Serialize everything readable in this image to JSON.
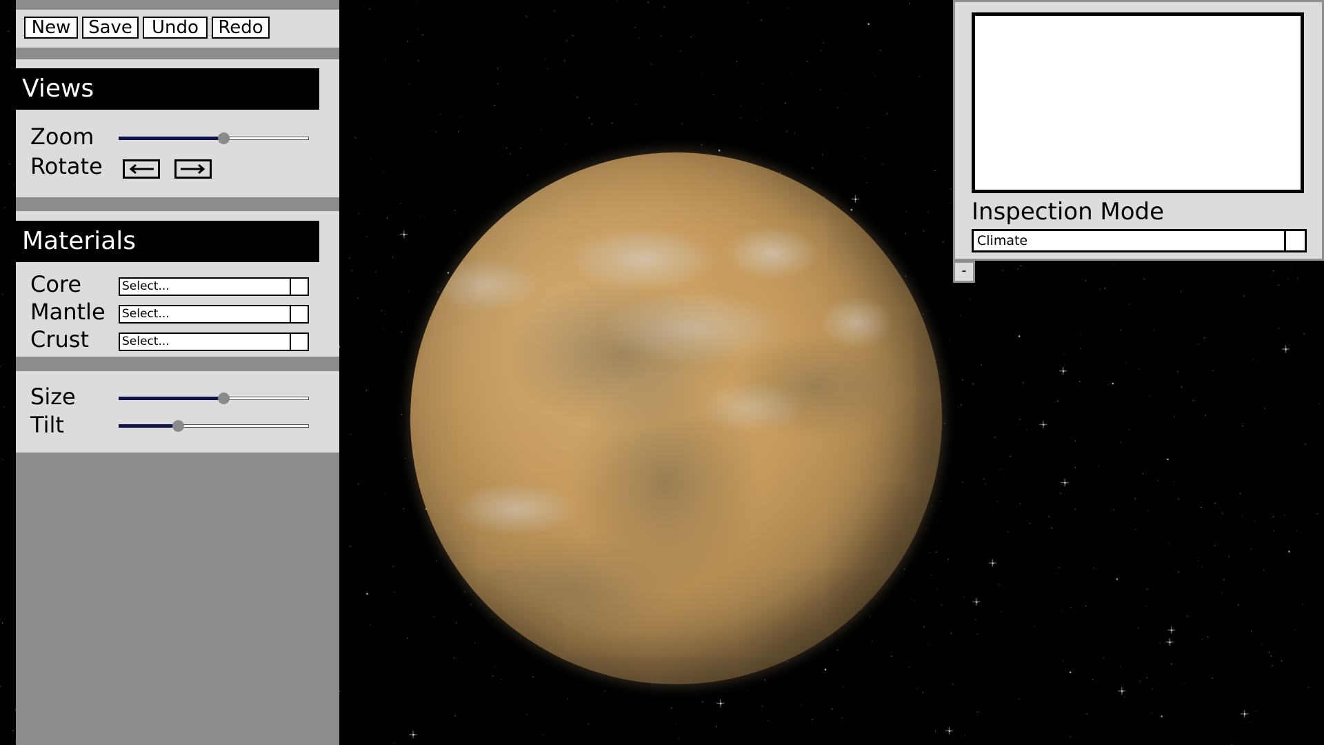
{
  "toolbar": {
    "new_label": "New",
    "save_label": "Save",
    "undo_label": "Undo",
    "redo_label": "Redo"
  },
  "views": {
    "header": "Views",
    "zoom_label": "Zoom",
    "zoom_value": 0.55,
    "rotate_label": "Rotate",
    "rotate_left_icon": "arrow-left-icon",
    "rotate_right_icon": "arrow-right-icon"
  },
  "materials": {
    "header": "Materials",
    "rows": [
      {
        "label": "Core",
        "value": "Select..."
      },
      {
        "label": "Mantle",
        "value": "Select..."
      },
      {
        "label": "Crust",
        "value": "Select..."
      }
    ]
  },
  "properties": {
    "size_label": "Size",
    "size_value": 0.55,
    "tilt_label": "Tilt",
    "tilt_value": 0.31
  },
  "inspection": {
    "title": "Inspection Mode",
    "selected": "Climate",
    "collapse_label": "-"
  },
  "colors": {
    "panel": "#dcdcdc",
    "panel_dark": "#8c8c8c",
    "header_bg": "#000000",
    "slider_fill": "#12124a",
    "planet": "#c59a5c"
  }
}
